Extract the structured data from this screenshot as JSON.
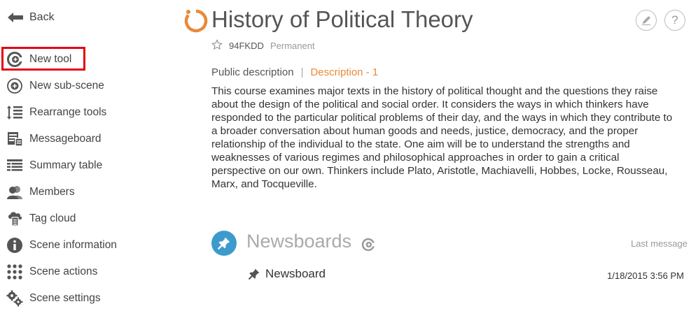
{
  "sidebar": {
    "back_label": "Back",
    "items": [
      {
        "label": "New tool",
        "icon": "new-tool-icon"
      },
      {
        "label": "New sub-scene",
        "icon": "new-sub-scene-icon"
      },
      {
        "label": "Rearrange tools",
        "icon": "rearrange-icon"
      },
      {
        "label": "Messageboard",
        "icon": "messageboard-icon"
      },
      {
        "label": "Summary table",
        "icon": "summary-table-icon"
      },
      {
        "label": "Members",
        "icon": "members-icon"
      },
      {
        "label": "Tag cloud",
        "icon": "tag-cloud-icon"
      },
      {
        "label": "Scene information",
        "icon": "info-icon"
      },
      {
        "label": "Scene actions",
        "icon": "actions-icon"
      },
      {
        "label": "Scene settings",
        "icon": "settings-icon"
      }
    ]
  },
  "header": {
    "title": "History of Political Theory",
    "code": "94FKDD",
    "status": "Permanent",
    "edit_icon": "pencil-icon",
    "help_label": "?"
  },
  "description": {
    "tab_public": "Public description",
    "tab_separator": "|",
    "tab_active": "Description - 1",
    "text": "This course examines major texts in the history of political thought and the questions they raise about the design of the political and social order. It considers the ways in which thinkers have responded to the particular political problems of their day, and the ways in which they contribute to a broader conversation about human goods and needs, justice, democracy, and the proper relationship of the individual to the state. One aim will be to understand the strengths and weaknesses of various regimes and philosophical approaches in order to gain a critical perspective on our own. Thinkers include Plato, Aristotle, Machiavelli, Hobbes, Locke, Rousseau, Marx, and Tocqueville."
  },
  "newsboards": {
    "title": "Newsboards",
    "last_message_label": "Last message",
    "rows": [
      {
        "name": "Newsboard",
        "date": "1/18/2015 3:56 PM"
      }
    ]
  },
  "colors": {
    "accent": "#e88a3a",
    "highlight": "#e30613",
    "newsboard_icon": "#3c9bcc"
  }
}
